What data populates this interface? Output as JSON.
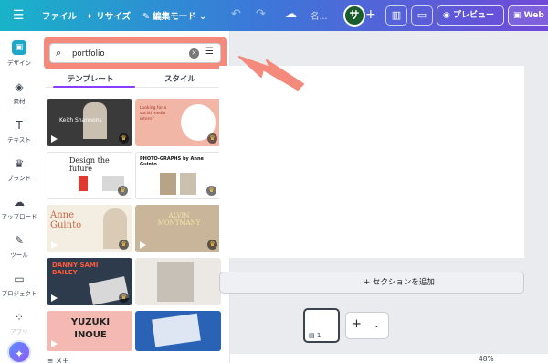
{
  "topbar": {
    "menu_icon": "hamburger-icon",
    "file": "ファイル",
    "resize": "リサイズ",
    "edit_mode": "編集モード",
    "title": "名...",
    "avatar": "サ",
    "preview": "プレビュー",
    "web": "Web"
  },
  "rail": [
    {
      "label": "デザイン",
      "icon": "design-icon"
    },
    {
      "label": "素材",
      "icon": "elements-icon"
    },
    {
      "label": "テキスト",
      "icon": "text-icon"
    },
    {
      "label": "ブランド",
      "icon": "brand-icon"
    },
    {
      "label": "アップロード",
      "icon": "upload-icon"
    },
    {
      "label": "ツール",
      "icon": "tools-icon"
    },
    {
      "label": "プロジェクト",
      "icon": "projects-icon"
    },
    {
      "label": "アプリ",
      "icon": "apps-icon"
    }
  ],
  "search": {
    "value": "portfolio",
    "placeholder": "検索"
  },
  "tabs": [
    "テンプレート",
    "スタイル"
  ],
  "templates": [
    {
      "text": "Keith Shannons",
      "bg": "#3a3a3a",
      "video": true
    },
    {
      "text": "Looking for a social media intern?",
      "bg": "#f1b6a6",
      "video": false
    },
    {
      "text": "Design the future",
      "bg": "#ffffff",
      "video": false
    },
    {
      "text": "PHOTO-GRAPHS by Anne Guinto",
      "bg": "#ffffff",
      "video": true
    },
    {
      "text": "Anne Guinto",
      "bg": "#f4ede2",
      "video": true
    },
    {
      "text": "ALVIN MONTMANY",
      "bg": "#c9b69a",
      "video": true
    },
    {
      "text": "DANNY SAMI BAILEY",
      "bg": "#2d3b4d",
      "video": true
    },
    {
      "text": "",
      "bg": "#ece9e4",
      "video": false
    },
    {
      "text": "YUZUKI INOUE",
      "bg": "#f3b9b2",
      "video": true
    },
    {
      "text": "",
      "bg": "#2a63b6",
      "video": false
    }
  ],
  "workspace": {
    "add_section": "+ セクションを追加",
    "page_number": "1",
    "notes": "メモ",
    "zoom": "48%"
  },
  "colors": {
    "accent": "#8b3dff",
    "highlight": "#f48a7b"
  }
}
